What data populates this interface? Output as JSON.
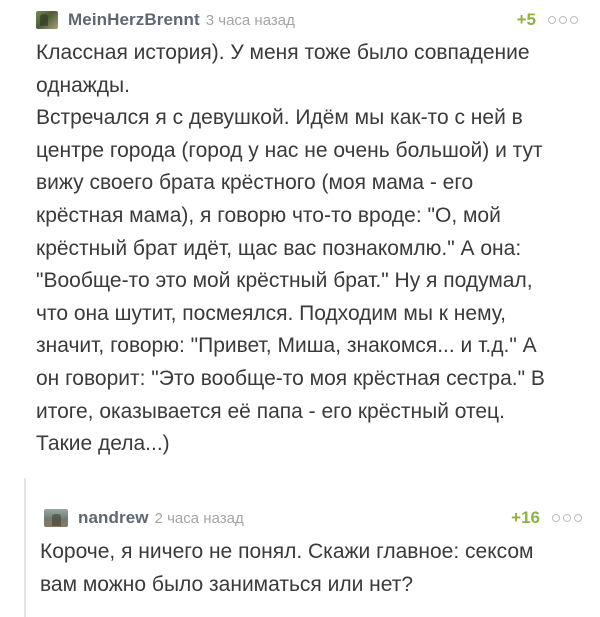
{
  "comments": [
    {
      "author": "MeinHerzBrennt",
      "time": "3 часа назад",
      "rating": "+5",
      "lines": [
        "Классная история). У меня тоже было совпадение",
        "однажды.",
        "Встречался я с девушкой. Идём мы как-то с ней в",
        "центре города (город у нас не очень большой) и тут",
        "вижу своего брата крёстного (моя мама - его",
        "крёстная мама), я говорю что-то вроде: \"О, мой",
        "крёстный брат идёт, щас вас познакомлю.\" А она:",
        "\"Вообще-то это мой крёстный брат.\" Ну я подумал,",
        "что она шутит, посмеялся. Подходим мы к нему,",
        "значит, говорю: \"Привет, Миша, знакомся... и т.д.\" А",
        "он говорит: \"Это вообще-то моя крёстная сестра.\" В",
        "итоге, оказывается её папа - его крёстный отец.",
        "Такие дела...)"
      ]
    },
    {
      "author": "nandrew",
      "time": "2 часа назад",
      "rating": "+16",
      "lines": [
        "Короче, я ничего не понял. Скажи главное: сексом",
        "вам можно было заниматься или нет?"
      ]
    }
  ],
  "colors": {
    "rating": "#8cb33f",
    "username": "#5e6772",
    "time": "#a5a5a5"
  },
  "icons": {
    "avatar": "user-avatar-image",
    "more": "more-options-icon"
  }
}
